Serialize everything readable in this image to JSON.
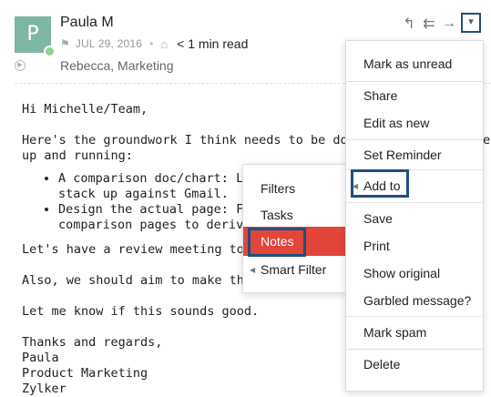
{
  "header": {
    "avatar_letter": "P",
    "sender": "Paula M",
    "date": "JUL 29, 2016",
    "separator": "•",
    "read_time": "< 1 min read",
    "recipients": "Rebecca, Marketing",
    "icons": [
      "reply-icon",
      "reply-all-icon",
      "forward-icon",
      "dropdown-icon"
    ]
  },
  "body": {
    "greeting": "Hi Michelle/Team,",
    "para1_line1": "Here's the groundwork I think needs to be done to g",
    "para1_line1_tail": "e",
    "para1_line2": "up and running:",
    "bullet1_line1": "A comparison doc/chart: Let's",
    "bullet1_line2": "stack up against Gmail.",
    "bullet2_line1": "Design the actual page: Feel f",
    "bullet2_line2": "comparison pages to derive in",
    "review": "Let's have a review meeting to discu",
    "aim": "Also, we should aim to make this liv",
    "know": "Let me know if this sounds good.",
    "sign1": "Thanks and regards,",
    "sign2": "Paula",
    "sign3": "Product Marketing",
    "sign4": "Zylker"
  },
  "menu": {
    "items": [
      "Mark as unread",
      "Share",
      "Edit as new",
      "Set Reminder",
      "Add to",
      "Save",
      "Print",
      "Show original",
      "Garbled message?",
      "Mark spam",
      "Delete"
    ]
  },
  "submenu": {
    "items": [
      "Filters",
      "Tasks",
      "Notes",
      "Smart Filter"
    ]
  },
  "colors": {
    "avatar": "#7fb5a4",
    "highlight_box": "#1f4f80",
    "active_item": "#e2453a"
  }
}
